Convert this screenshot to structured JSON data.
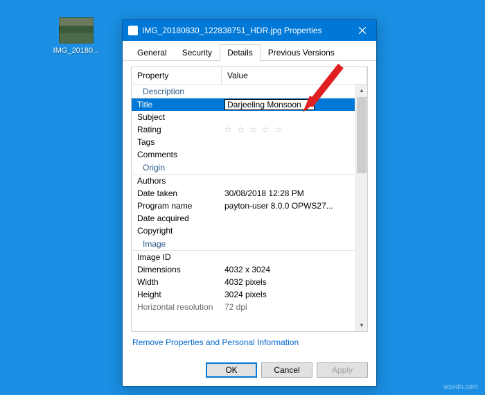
{
  "desktop": {
    "file_label": "IMG_20180..."
  },
  "dialog": {
    "title": "IMG_20180830_122838751_HDR.jpg Properties",
    "tabs": [
      "General",
      "Security",
      "Details",
      "Previous Versions"
    ],
    "active_tab": "Details",
    "columns": {
      "property": "Property",
      "value": "Value"
    },
    "sections": {
      "description": {
        "header": "Description",
        "rows": {
          "title": {
            "label": "Title",
            "value": "Darjeeling Monsoon"
          },
          "subject": {
            "label": "Subject",
            "value": ""
          },
          "rating": {
            "label": "Rating",
            "value": ""
          },
          "tags": {
            "label": "Tags",
            "value": ""
          },
          "comments": {
            "label": "Comments",
            "value": ""
          }
        }
      },
      "origin": {
        "header": "Origin",
        "rows": {
          "authors": {
            "label": "Authors",
            "value": ""
          },
          "date_taken": {
            "label": "Date taken",
            "value": "30/08/2018 12:28 PM"
          },
          "program_name": {
            "label": "Program name",
            "value": "payton-user 8.0.0 OPWS27..."
          },
          "date_acquired": {
            "label": "Date acquired",
            "value": ""
          },
          "copyright": {
            "label": "Copyright",
            "value": ""
          }
        }
      },
      "image": {
        "header": "Image",
        "rows": {
          "image_id": {
            "label": "Image ID",
            "value": ""
          },
          "dimensions": {
            "label": "Dimensions",
            "value": "4032 x 3024"
          },
          "width": {
            "label": "Width",
            "value": "4032 pixels"
          },
          "height": {
            "label": "Height",
            "value": "3024 pixels"
          },
          "hres": {
            "label": "Horizontal resolution",
            "value": "72 dpi"
          }
        }
      }
    },
    "link": "Remove Properties and Personal Information",
    "buttons": {
      "ok": "OK",
      "cancel": "Cancel",
      "apply": "Apply"
    }
  },
  "rating_stars": "☆ ☆ ☆ ☆ ☆",
  "watermark": "wsxdn.com"
}
